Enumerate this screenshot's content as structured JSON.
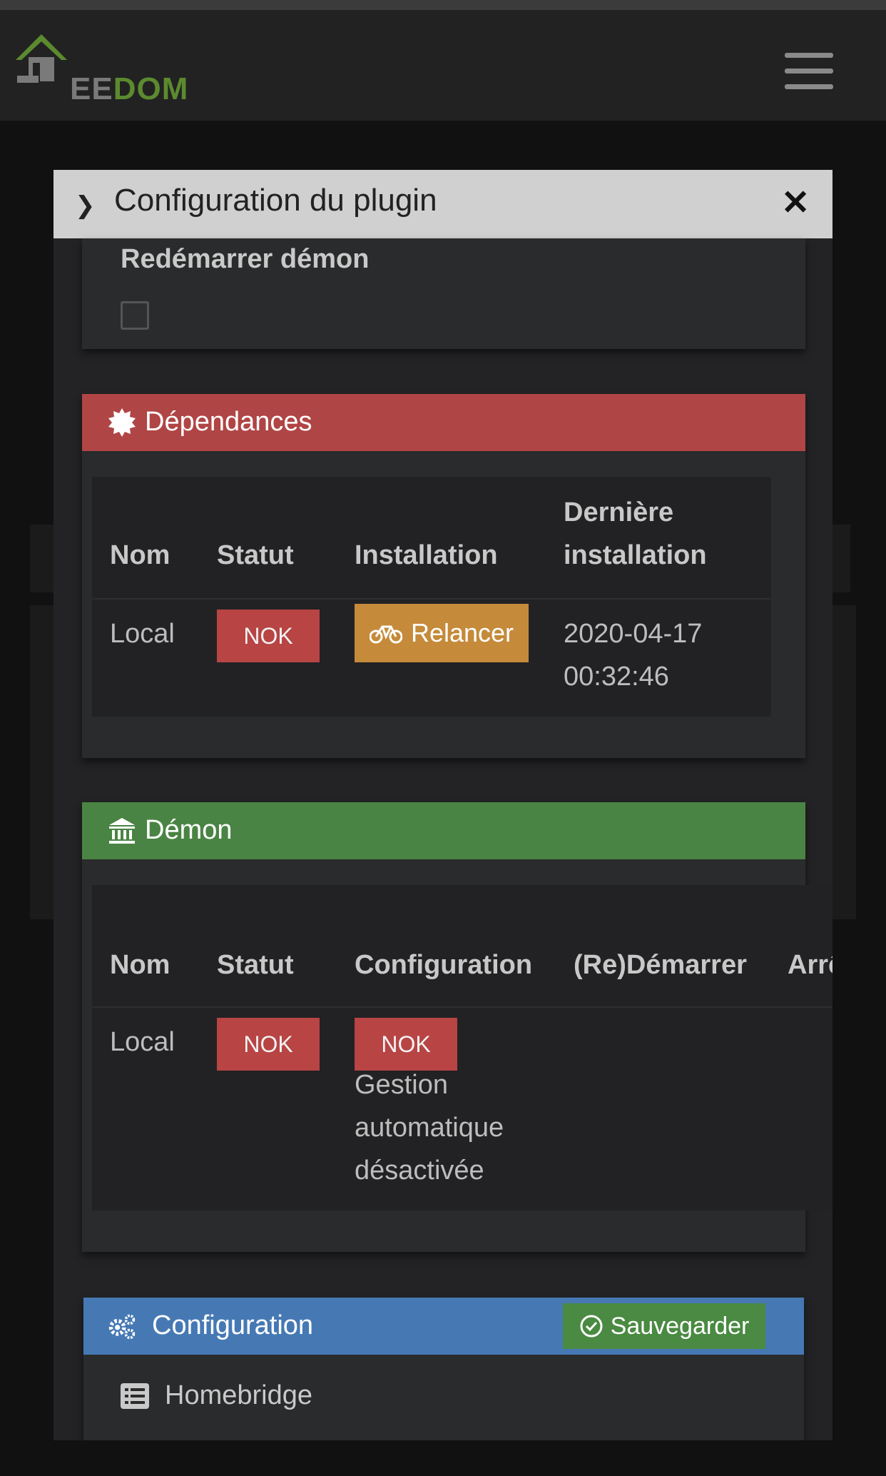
{
  "app": {
    "logo_alt": "Jeedom",
    "logo_small_text": "",
    "logo_text_ee": "EE",
    "logo_text_dom": "DOM"
  },
  "modal": {
    "title": "Configuration du plugin"
  },
  "restart_section": {
    "label": "Redémarrer démon"
  },
  "dependencies": {
    "header": "Dépendances",
    "color": "#b04545",
    "columns": [
      "Nom",
      "Statut",
      "Installation",
      "Dernière",
      "installation"
    ],
    "row": {
      "name": "Local",
      "status": "NOK",
      "action": "Relancer",
      "last_install_date": "2020-04-17",
      "last_install_time": "00:32:46"
    }
  },
  "daemon": {
    "header": "Démon",
    "color": "#4a8444",
    "columns": [
      "Nom",
      "Statut",
      "Configuration",
      "(Re)Démarrer",
      "Arrê"
    ],
    "row": {
      "name": "Local",
      "status": "NOK",
      "config_status": "NOK",
      "note_line1": "Gestion",
      "note_line2": "automatique",
      "note_line3": "désactivée"
    }
  },
  "configuration": {
    "header": "Configuration",
    "color": "#4679b4",
    "save_label": "Sauvegarder",
    "item": "Homebridge"
  }
}
